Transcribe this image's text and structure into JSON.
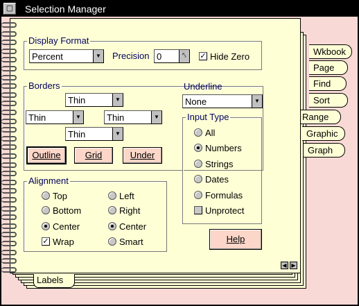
{
  "window": {
    "title": "Selection Manager",
    "system_icon": "system-menu-icon"
  },
  "display_format": {
    "label": "Display Format",
    "format_value": "Percent",
    "precision_label": "Precision",
    "precision_value": "0",
    "hide_zero_label": "Hide Zero",
    "hide_zero_checked": true
  },
  "borders": {
    "label": "Borders",
    "top": "Thin",
    "left": "Thin",
    "right": "Thin",
    "bottom": "Thin",
    "buttons": {
      "outline": "Outline",
      "grid": "Grid",
      "under": "Under"
    }
  },
  "underline": {
    "label": "Underline",
    "value": "None"
  },
  "input_type": {
    "label": "Input Type",
    "options": [
      {
        "label": "All",
        "selected": false
      },
      {
        "label": "Numbers",
        "selected": true
      },
      {
        "label": "Strings",
        "selected": false
      },
      {
        "label": "Dates",
        "selected": false
      },
      {
        "label": "Formulas",
        "selected": false
      }
    ],
    "unprotect_label": "Unprotect",
    "unprotect_checked": false
  },
  "alignment": {
    "label": "Alignment",
    "vertical": [
      {
        "label": "Top",
        "selected": false
      },
      {
        "label": "Bottom",
        "selected": false
      },
      {
        "label": "Center",
        "selected": true
      }
    ],
    "wrap_label": "Wrap",
    "wrap_checked": true,
    "horizontal": [
      {
        "label": "Left",
        "selected": false
      },
      {
        "label": "Right",
        "selected": false
      },
      {
        "label": "Center",
        "selected": true
      },
      {
        "label": "Smart",
        "selected": false
      }
    ]
  },
  "help_label": "Help",
  "tabs": [
    "Wkbook",
    "Page",
    "Find",
    "Sort",
    "Range",
    "Graphic",
    "Graph"
  ],
  "active_tab": "Range",
  "bottom_tab": "Labels",
  "colors": {
    "page": "#ffffd6",
    "background": "#f9d9d5",
    "button": "#fcd6c8",
    "label": "#000060"
  }
}
